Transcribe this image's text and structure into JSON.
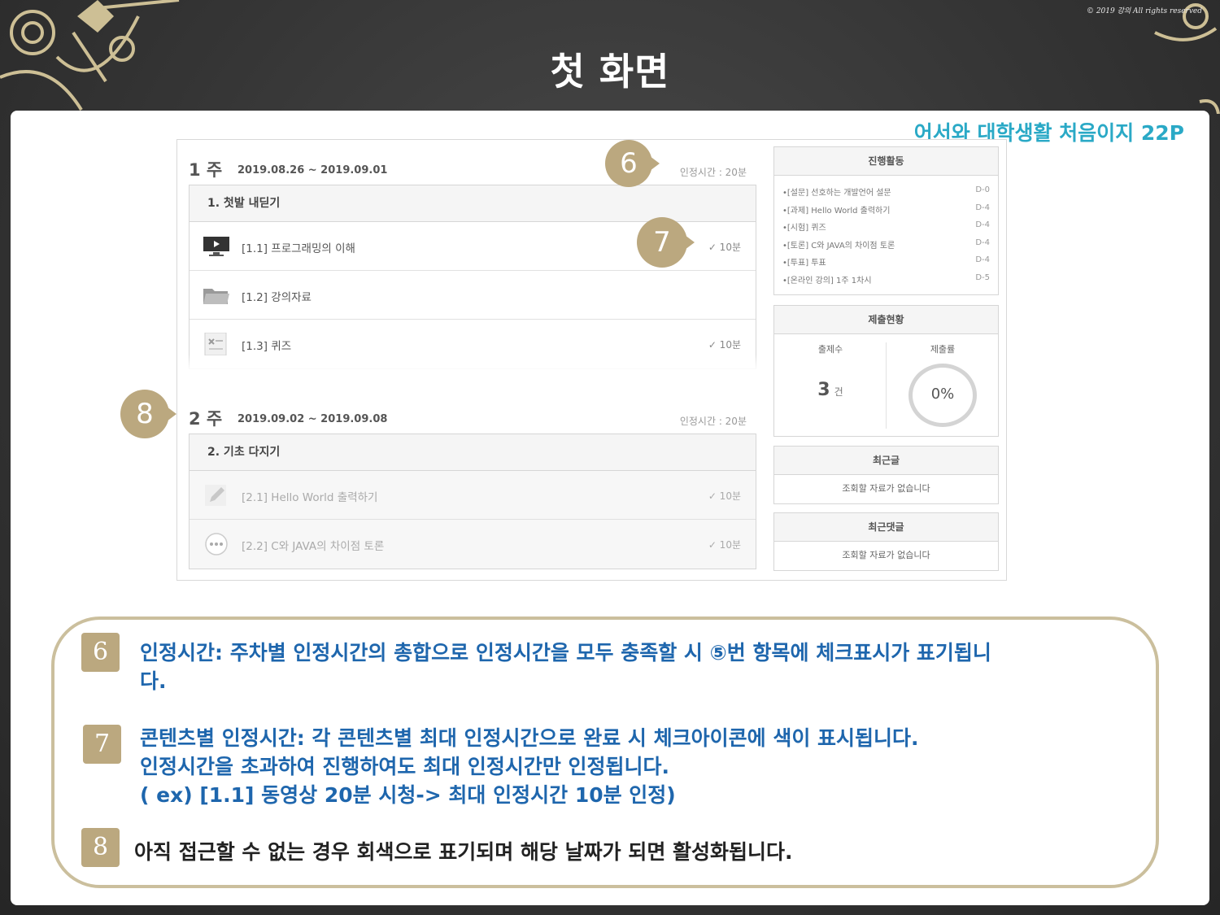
{
  "slide": {
    "title": "첫 화면",
    "copyright": "© 2019 강의 All rights reserved",
    "ref_caption": "어서와 대학생활 처음이지 22P"
  },
  "weeks": [
    {
      "num": "1 주",
      "dates": "2019.08.26 ~ 2019.09.01",
      "time": "인정시간 : 20분",
      "section_title": "1. 첫발 내딛기",
      "items": [
        {
          "icon": "monitor-icon",
          "label": "[1.1] 프로그래밍의 이해",
          "check": "✓ 10분",
          "locked": false
        },
        {
          "icon": "folder-icon",
          "label": "[1.2] 강의자료",
          "check": "",
          "locked": false
        },
        {
          "icon": "quiz-icon",
          "label": "[1.3] 퀴즈",
          "check": "✓ 10분",
          "locked": false
        }
      ]
    },
    {
      "num": "2 주",
      "dates": "2019.09.02 ~ 2019.09.08",
      "time": "인정시간 : 20분",
      "section_title": "2. 기초 다지기",
      "items": [
        {
          "icon": "pencil-icon",
          "label": "[2.1] Hello World 출력하기",
          "check": "✓ 10분",
          "locked": true
        },
        {
          "icon": "discussion-icon",
          "label": "[2.2] C와 JAVA의 차이점 토론",
          "check": "✓ 10분",
          "locked": true
        }
      ]
    }
  ],
  "sidebar": {
    "activity": {
      "title": "진행활동",
      "items": [
        {
          "text": "•[설문] 선호하는 개발언어 설문",
          "dday": "D-0"
        },
        {
          "text": "•[과제] Hello World 출력하기",
          "dday": "D-4"
        },
        {
          "text": "•[시험] 퀴즈",
          "dday": "D-4"
        },
        {
          "text": "•[토론] C와 JAVA의 차이점 토론",
          "dday": "D-4"
        },
        {
          "text": "•[투표] 투표",
          "dday": "D-4"
        },
        {
          "text": "•[온라인 강의] 1주 1차시",
          "dday": "D-5"
        }
      ]
    },
    "submission": {
      "title": "제출현황",
      "count_label": "출제수",
      "count_value": "3",
      "count_unit": "건",
      "rate_label": "제출률",
      "rate_value": "0%"
    },
    "recent_posts": {
      "title": "최근글",
      "empty": "조회할 자료가 없습니다"
    },
    "recent_comments": {
      "title": "최근댓글",
      "empty": "조회할 자료가 없습니다"
    }
  },
  "badges": {
    "b6": "6",
    "b7": "7",
    "b8": "8"
  },
  "notes": [
    {
      "num": "6",
      "text": "인정시간: 주차별 인정시간의 총합으로 인정시간을 모두 충족할 시 ⑤번 항목에 체크표시가 표기됩니\n다."
    },
    {
      "num": "7",
      "text": "콘텐츠별 인정시간: 각 콘텐츠별 최대 인정시간으로 완료 시 체크아이콘에 색이 표시됩니다.\n인정시간을 초과하여 진행하여도 최대 인정시간만 인정됩니다.\n( ex) [1.1] 동영상 20분 시청-> 최대 인정시간 10분 인정)"
    },
    {
      "num": "8",
      "text": "아직 접근할 수 없는 경우 회색으로 표기되며 해당 날짜가 되면 활성화됩니다."
    }
  ],
  "colors": {
    "accent_gold": "#bba87f",
    "note_blue": "#1e66ad",
    "caption_teal": "#2aa9c6"
  }
}
